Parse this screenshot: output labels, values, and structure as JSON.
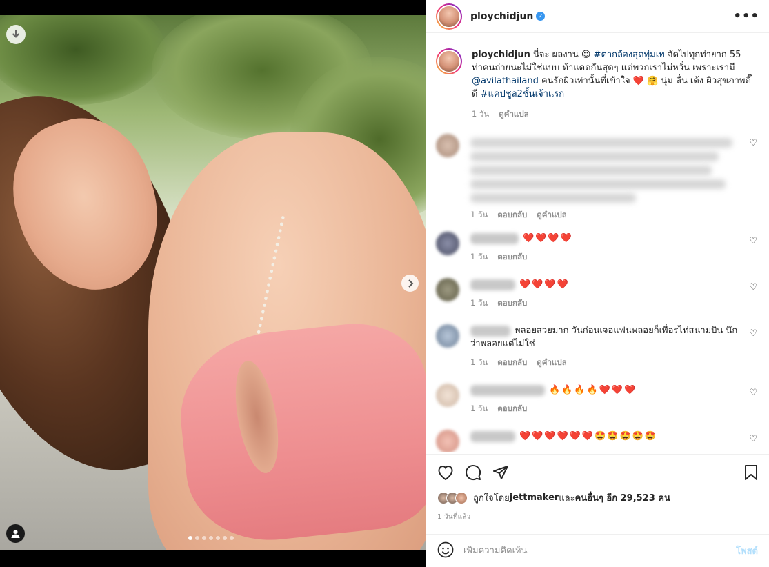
{
  "post": {
    "username": "ploychidjun",
    "more_label": "•••",
    "carousel": {
      "slide_count": 7,
      "active_index": 0
    }
  },
  "caption": {
    "username": "ploychidjun",
    "text_1": " นี่จะ ผลงาน ☺ ",
    "tag_1": "#ตากล้องสุดทุ่มเท",
    "text_2": " จัดไปทุกท่ายาก 55 ท่าคนถ่ายนะไม่ใช่แบบ ท้าแดดกันสุดๆ แต่พวกเราไม่หวั่น เพราะเรามี ",
    "mention": "@avilathailand",
    "text_3": " คนรักผิวเท่านั้นที่เข้าใจ ❤️ 🤗 นุ่ม ลื่น เด้ง ผิวสุขภาพดี๊ดี ",
    "tag_2": "#แคปซูล2ชั้นเจ้าแรก",
    "time": "1 วัน",
    "translate": "ดูคำแปล"
  },
  "comments": [
    {
      "text": "",
      "time": "1 วัน",
      "reply": "ตอบกลับ",
      "translate": "ดูคำแปล"
    },
    {
      "text": "❤️❤️❤️❤️",
      "time": "1 วัน",
      "reply": "ตอบกลับ"
    },
    {
      "text": "❤️❤️❤️❤️",
      "time": "1 วัน",
      "reply": "ตอบกลับ"
    },
    {
      "text": "พลอยสวยมาก วันก่อนเจอแฟนพลอยก็เพื่อรไท่สนามบิน นึกว่าพลอยแต่ไม่ใช่",
      "time": "1 วัน",
      "reply": "ตอบกลับ",
      "translate": "ดูคำแปล"
    },
    {
      "text": "🔥🔥🔥🔥❤️❤️❤️",
      "time": "1 วัน",
      "reply": "ตอบกลับ"
    },
    {
      "text": "❤️❤️❤️❤️❤️❤️🤩🤩🤩🤩🤩",
      "time": "",
      "reply": ""
    }
  ],
  "likes": {
    "prefix": "ถูกใจโดย ",
    "user": "jettmaker",
    "middle": " และ",
    "others": "คนอื่นๆ อีก 29,523 คน"
  },
  "post_time": "1 วันที่แล้ว",
  "add_comment": {
    "placeholder": "เพิ่มความคิดเห็น",
    "post_label": "โพสต์"
  },
  "colors": {
    "link": "#00376b",
    "verified": "#3897f0",
    "post_disabled": "#b2dffc"
  }
}
